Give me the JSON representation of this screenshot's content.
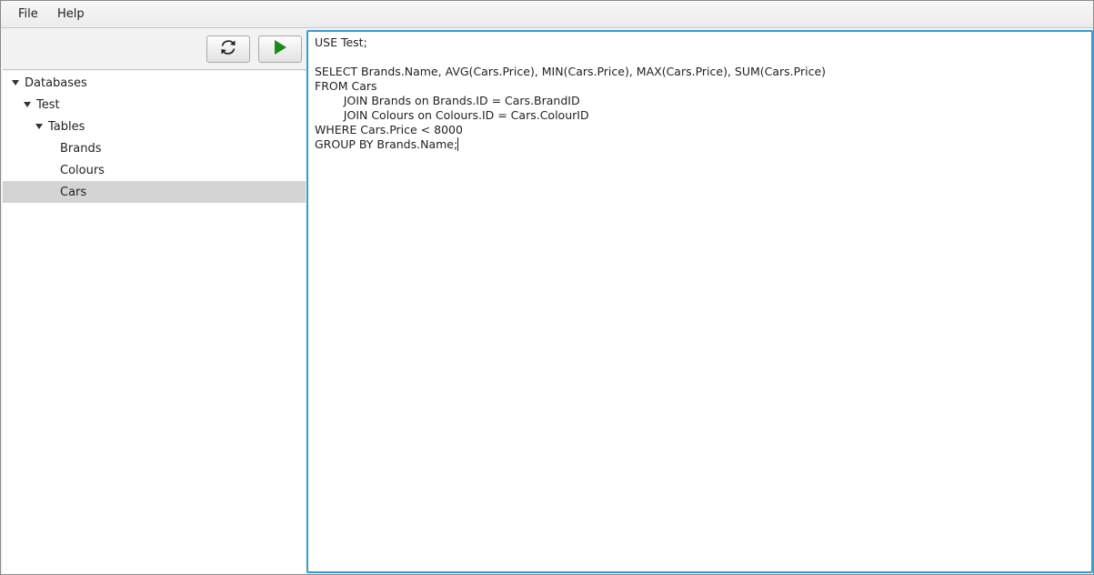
{
  "menu": {
    "file": "File",
    "help": "Help"
  },
  "toolbar": {
    "refresh_icon": "refresh-icon",
    "run_icon": "play-icon",
    "run_color": "#1a8a1a"
  },
  "tree": {
    "items": [
      {
        "label": "Databases",
        "level": 0,
        "expanded": true
      },
      {
        "label": "Test",
        "level": 1,
        "expanded": true
      },
      {
        "label": "Tables",
        "level": 2,
        "expanded": true
      },
      {
        "label": "Brands",
        "level": 3
      },
      {
        "label": "Colours",
        "level": 3
      },
      {
        "label": "Cars",
        "level": 3,
        "selected": true
      }
    ]
  },
  "editor": {
    "focus_color": "#3a9bd3",
    "lines": [
      "USE Test;",
      "",
      "SELECT Brands.Name, AVG(Cars.Price), MIN(Cars.Price), MAX(Cars.Price), SUM(Cars.Price)",
      "FROM Cars",
      "        JOIN Brands on Brands.ID = Cars.BrandID",
      "        JOIN Colours on Colours.ID = Cars.ColourID",
      "WHERE Cars.Price < 8000",
      "GROUP BY Brands.Name;"
    ]
  }
}
